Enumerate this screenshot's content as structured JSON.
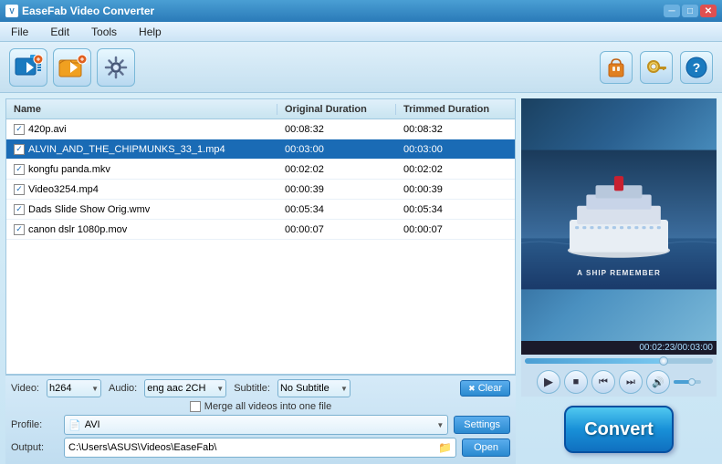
{
  "titlebar": {
    "title": "EaseFab Video Converter",
    "min_label": "─",
    "max_label": "□",
    "close_label": "✕"
  },
  "menu": {
    "items": [
      "File",
      "Edit",
      "Tools",
      "Help"
    ]
  },
  "toolbar": {
    "add_video_label": "➕🎬",
    "add_folder_label": "📁🎬",
    "settings_gear_label": "⚙"
  },
  "file_list": {
    "headers": [
      "Name",
      "Original Duration",
      "Trimmed Duration"
    ],
    "files": [
      {
        "name": "420p.avi",
        "original": "00:08:32",
        "trimmed": "00:08:32",
        "checked": true,
        "selected": false
      },
      {
        "name": "ALVIN_AND_THE_CHIPMUNKS_33_1.mp4",
        "original": "00:03:00",
        "trimmed": "00:03:00",
        "checked": true,
        "selected": true
      },
      {
        "name": "kongfu panda.mkv",
        "original": "00:02:02",
        "trimmed": "00:02:02",
        "checked": true,
        "selected": false
      },
      {
        "name": "Video3254.mp4",
        "original": "00:00:39",
        "trimmed": "00:00:39",
        "checked": true,
        "selected": false
      },
      {
        "name": "Dads Slide Show Orig.wmv",
        "original": "00:05:34",
        "trimmed": "00:05:34",
        "checked": true,
        "selected": false
      },
      {
        "name": "canon dslr 1080p.mov",
        "original": "00:00:07",
        "trimmed": "00:00:07",
        "checked": true,
        "selected": false
      }
    ]
  },
  "controls": {
    "video_label": "Video:",
    "video_value": "h264",
    "audio_label": "Audio:",
    "audio_value": "eng aac 2CH",
    "subtitle_label": "Subtitle:",
    "subtitle_value": "No Subtitle",
    "clear_label": "✖ Clear",
    "merge_label": "Merge all videos into one file"
  },
  "profile": {
    "label": "Profile:",
    "value": "AVI",
    "settings_label": "Settings"
  },
  "output": {
    "label": "Output:",
    "path": "C:\\Users\\ASUS\\Videos\\EaseFab\\",
    "open_label": "Open"
  },
  "video_preview": {
    "timestamp": "00:02:23/00:03:00",
    "text_overlay": "A SHIP REMEMBER"
  },
  "convert": {
    "label": "Convert"
  }
}
